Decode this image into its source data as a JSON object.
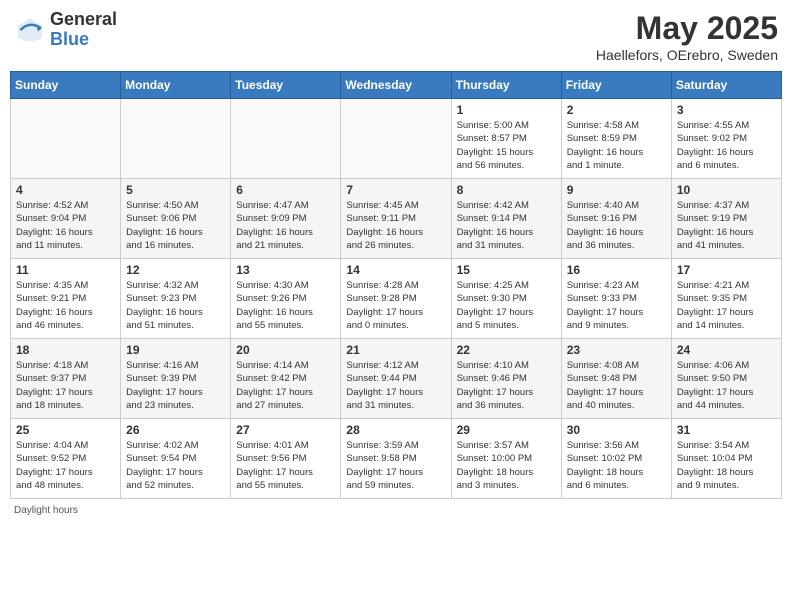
{
  "header": {
    "logo_general": "General",
    "logo_blue": "Blue",
    "title": "May 2025",
    "location": "Haellefors, OErebro, Sweden"
  },
  "days_of_week": [
    "Sunday",
    "Monday",
    "Tuesday",
    "Wednesday",
    "Thursday",
    "Friday",
    "Saturday"
  ],
  "weeks": [
    [
      {
        "day": "",
        "info": ""
      },
      {
        "day": "",
        "info": ""
      },
      {
        "day": "",
        "info": ""
      },
      {
        "day": "",
        "info": ""
      },
      {
        "day": "1",
        "info": "Sunrise: 5:00 AM\nSunset: 8:57 PM\nDaylight: 15 hours\nand 56 minutes."
      },
      {
        "day": "2",
        "info": "Sunrise: 4:58 AM\nSunset: 8:59 PM\nDaylight: 16 hours\nand 1 minute."
      },
      {
        "day": "3",
        "info": "Sunrise: 4:55 AM\nSunset: 9:02 PM\nDaylight: 16 hours\nand 6 minutes."
      }
    ],
    [
      {
        "day": "4",
        "info": "Sunrise: 4:52 AM\nSunset: 9:04 PM\nDaylight: 16 hours\nand 11 minutes."
      },
      {
        "day": "5",
        "info": "Sunrise: 4:50 AM\nSunset: 9:06 PM\nDaylight: 16 hours\nand 16 minutes."
      },
      {
        "day": "6",
        "info": "Sunrise: 4:47 AM\nSunset: 9:09 PM\nDaylight: 16 hours\nand 21 minutes."
      },
      {
        "day": "7",
        "info": "Sunrise: 4:45 AM\nSunset: 9:11 PM\nDaylight: 16 hours\nand 26 minutes."
      },
      {
        "day": "8",
        "info": "Sunrise: 4:42 AM\nSunset: 9:14 PM\nDaylight: 16 hours\nand 31 minutes."
      },
      {
        "day": "9",
        "info": "Sunrise: 4:40 AM\nSunset: 9:16 PM\nDaylight: 16 hours\nand 36 minutes."
      },
      {
        "day": "10",
        "info": "Sunrise: 4:37 AM\nSunset: 9:19 PM\nDaylight: 16 hours\nand 41 minutes."
      }
    ],
    [
      {
        "day": "11",
        "info": "Sunrise: 4:35 AM\nSunset: 9:21 PM\nDaylight: 16 hours\nand 46 minutes."
      },
      {
        "day": "12",
        "info": "Sunrise: 4:32 AM\nSunset: 9:23 PM\nDaylight: 16 hours\nand 51 minutes."
      },
      {
        "day": "13",
        "info": "Sunrise: 4:30 AM\nSunset: 9:26 PM\nDaylight: 16 hours\nand 55 minutes."
      },
      {
        "day": "14",
        "info": "Sunrise: 4:28 AM\nSunset: 9:28 PM\nDaylight: 17 hours\nand 0 minutes."
      },
      {
        "day": "15",
        "info": "Sunrise: 4:25 AM\nSunset: 9:30 PM\nDaylight: 17 hours\nand 5 minutes."
      },
      {
        "day": "16",
        "info": "Sunrise: 4:23 AM\nSunset: 9:33 PM\nDaylight: 17 hours\nand 9 minutes."
      },
      {
        "day": "17",
        "info": "Sunrise: 4:21 AM\nSunset: 9:35 PM\nDaylight: 17 hours\nand 14 minutes."
      }
    ],
    [
      {
        "day": "18",
        "info": "Sunrise: 4:18 AM\nSunset: 9:37 PM\nDaylight: 17 hours\nand 18 minutes."
      },
      {
        "day": "19",
        "info": "Sunrise: 4:16 AM\nSunset: 9:39 PM\nDaylight: 17 hours\nand 23 minutes."
      },
      {
        "day": "20",
        "info": "Sunrise: 4:14 AM\nSunset: 9:42 PM\nDaylight: 17 hours\nand 27 minutes."
      },
      {
        "day": "21",
        "info": "Sunrise: 4:12 AM\nSunset: 9:44 PM\nDaylight: 17 hours\nand 31 minutes."
      },
      {
        "day": "22",
        "info": "Sunrise: 4:10 AM\nSunset: 9:46 PM\nDaylight: 17 hours\nand 36 minutes."
      },
      {
        "day": "23",
        "info": "Sunrise: 4:08 AM\nSunset: 9:48 PM\nDaylight: 17 hours\nand 40 minutes."
      },
      {
        "day": "24",
        "info": "Sunrise: 4:06 AM\nSunset: 9:50 PM\nDaylight: 17 hours\nand 44 minutes."
      }
    ],
    [
      {
        "day": "25",
        "info": "Sunrise: 4:04 AM\nSunset: 9:52 PM\nDaylight: 17 hours\nand 48 minutes."
      },
      {
        "day": "26",
        "info": "Sunrise: 4:02 AM\nSunset: 9:54 PM\nDaylight: 17 hours\nand 52 minutes."
      },
      {
        "day": "27",
        "info": "Sunrise: 4:01 AM\nSunset: 9:56 PM\nDaylight: 17 hours\nand 55 minutes."
      },
      {
        "day": "28",
        "info": "Sunrise: 3:59 AM\nSunset: 9:58 PM\nDaylight: 17 hours\nand 59 minutes."
      },
      {
        "day": "29",
        "info": "Sunrise: 3:57 AM\nSunset: 10:00 PM\nDaylight: 18 hours\nand 3 minutes."
      },
      {
        "day": "30",
        "info": "Sunrise: 3:56 AM\nSunset: 10:02 PM\nDaylight: 18 hours\nand 6 minutes."
      },
      {
        "day": "31",
        "info": "Sunrise: 3:54 AM\nSunset: 10:04 PM\nDaylight: 18 hours\nand 9 minutes."
      }
    ]
  ],
  "footer": {
    "daylight_hours_label": "Daylight hours"
  }
}
